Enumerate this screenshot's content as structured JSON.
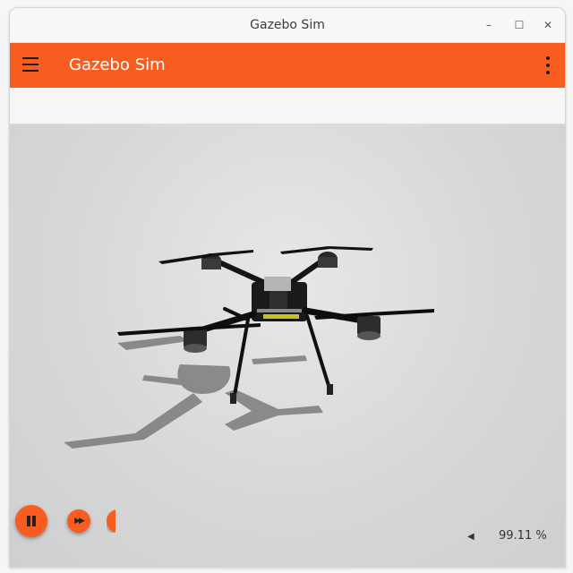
{
  "window": {
    "title": "Gazebo Sim",
    "buttons": {
      "minimize": "–",
      "maximize": "☐",
      "close": "✕"
    }
  },
  "appbar": {
    "title": "Gazebo Sim",
    "menu_icon": "hamburger-menu-icon",
    "more_icon": "kebab-menu-icon",
    "color": "#f95c1f"
  },
  "playback": {
    "state": "paused",
    "play_pause_icon": "pause-icon",
    "step_icon": "fast-forward-icon"
  },
  "stats": {
    "real_time_factor": "99.11 %",
    "expand_icon": "chevron-left-icon"
  }
}
